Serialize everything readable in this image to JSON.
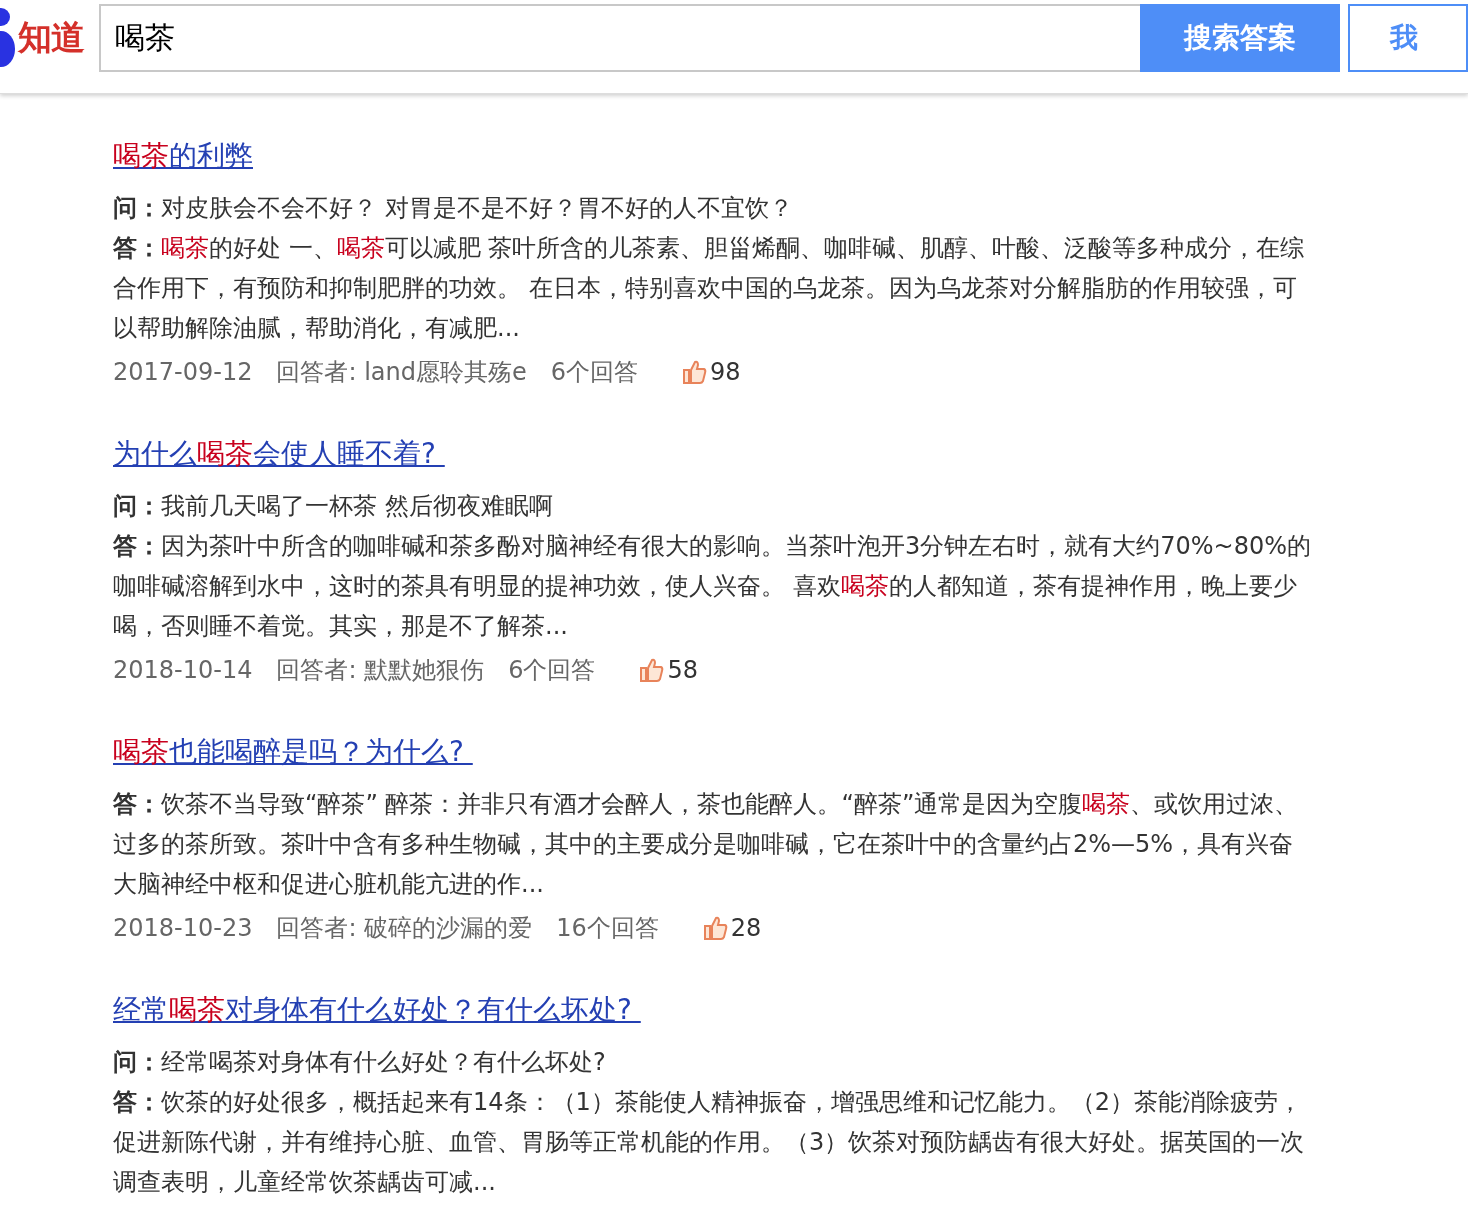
{
  "header": {
    "logo_text": "知道",
    "search": {
      "value": "喝茶"
    },
    "search_button": "搜索答案",
    "ask_button": "我"
  },
  "results": [
    {
      "title": [
        {
          "text": "喝茶",
          "highlight": true
        },
        {
          "text": "的利弊",
          "highlight": false
        }
      ],
      "question": {
        "label": "问：",
        "text": "对皮肤会不会不好？ 对胃是不是不好？胃不好的人不宜饮？"
      },
      "answer": {
        "label": "答：",
        "segments": [
          {
            "text": "喝茶",
            "highlight": true
          },
          {
            "text": "的好处 一、",
            "highlight": false
          },
          {
            "text": "喝茶",
            "highlight": true
          },
          {
            "text": "可以减肥 茶叶所含的儿茶素、胆甾烯酮、咖啡碱、肌醇、叶酸、泛酸等多种成分，在综合作用下，有预防和抑制肥胖的功效。 在日本，特别喜欢中国的乌龙茶。因为乌龙茶对分解脂肪的作用较强，可以帮助解除油腻，帮助消化，有减肥...",
            "highlight": false
          }
        ]
      },
      "date": "2017-09-12",
      "answerer": "回答者: land愿聆其殇e",
      "answers": "6个回答",
      "likes": "98"
    },
    {
      "title": [
        {
          "text": "为什么",
          "highlight": false
        },
        {
          "text": "喝茶",
          "highlight": true
        },
        {
          "text": "会使人睡不着? ",
          "highlight": false
        }
      ],
      "question": {
        "label": "问：",
        "text": "我前几天喝了一杯茶 然后彻夜难眠啊"
      },
      "answer": {
        "label": "答：",
        "segments": [
          {
            "text": "因为茶叶中所含的咖啡碱和茶多酚对脑神经有很大的影响。当茶叶泡开3分钟左右时，就有大约70%~80%的咖啡碱溶解到水中，这时的茶具有明显的提神功效，使人兴奋。 喜欢",
            "highlight": false
          },
          {
            "text": "喝茶",
            "highlight": true
          },
          {
            "text": "的人都知道，茶有提神作用，晚上要少喝，否则睡不着觉。其实，那是不了解茶...",
            "highlight": false
          }
        ]
      },
      "date": "2018-10-14",
      "answerer": "回答者: 默默她狠伤",
      "answers": "6个回答",
      "likes": "58"
    },
    {
      "title": [
        {
          "text": "喝茶",
          "highlight": true
        },
        {
          "text": "也能喝醉是吗？为什么? ",
          "highlight": false
        }
      ],
      "answer": {
        "label": "答：",
        "segments": [
          {
            "text": "饮茶不当导致“醉茶” 醉茶：并非只有酒才会醉人，茶也能醉人。“醉茶”通常是因为空腹",
            "highlight": false
          },
          {
            "text": "喝茶",
            "highlight": true
          },
          {
            "text": "、或饮用过浓、过多的茶所致。茶叶中含有多种生物碱，其中的主要成分是咖啡碱，它在茶叶中的含量约占2%—5%，具有兴奋大脑神经中枢和促进心脏机能亢进的作...",
            "highlight": false
          }
        ]
      },
      "date": "2018-10-23",
      "answerer": "回答者: 破碎的沙漏的爱",
      "answers": "16个回答",
      "likes": "28"
    },
    {
      "title": [
        {
          "text": "经常",
          "highlight": false
        },
        {
          "text": "喝茶",
          "highlight": true
        },
        {
          "text": "对身体有什么好处？有什么坏处? ",
          "highlight": false
        }
      ],
      "question": {
        "label": "问：",
        "text": "经常喝茶对身体有什么好处？有什么坏处?"
      },
      "answer": {
        "label": "答：",
        "segments": [
          {
            "text": "饮茶的好处很多，概括起来有14条：（1）茶能使人精神振奋，增强思维和记忆能力。（2）茶能消除疲劳，促进新陈代谢，并有维持心脏、血管、胃肠等正常机能的作用。（3）饮茶对预防龋齿有很大好处。据英国的一次调查表明，儿童经常饮茶龋齿可减...",
            "highlight": false
          }
        ]
      }
    }
  ]
}
